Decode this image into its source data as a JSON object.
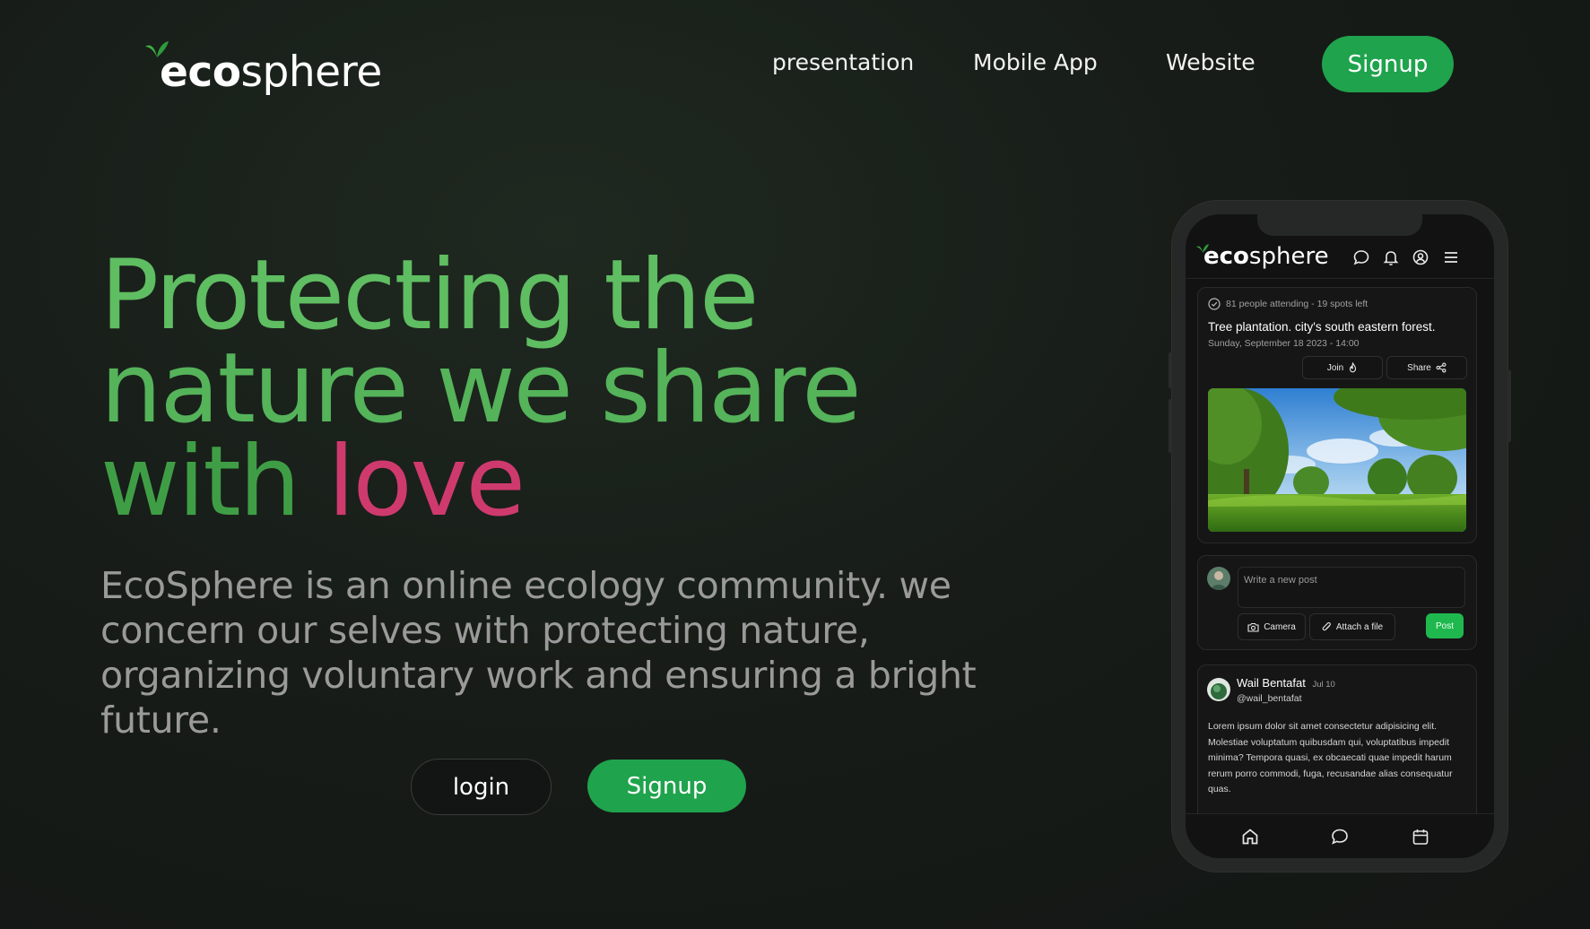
{
  "brand": {
    "bold": "eco",
    "light": "sphere",
    "accent": "#1fa34c",
    "leaf_color": "#3cb043"
  },
  "nav": {
    "items": [
      {
        "label": "presentation"
      },
      {
        "label": "Mobile App"
      },
      {
        "label": "Website"
      }
    ],
    "signup_label": "Signup"
  },
  "hero": {
    "line1": "Protecting the",
    "line2": "nature we share",
    "line3_prefix": "with ",
    "line3_highlight": "love",
    "description": "EcoSphere is an online ecology community. we concern our selves with protecting nature, organizing voluntary work and ensuring a bright future.",
    "login_label": "login",
    "signup_label": "Signup",
    "highlight_color": "#cf3a6e"
  },
  "phone": {
    "header": {
      "logo_bold": "eco",
      "logo_light": "sphere",
      "icons": [
        "chat-icon",
        "bell-icon",
        "user-circle-icon",
        "menu-icon"
      ]
    },
    "event": {
      "attendance": "81 people attending - 19 spots left",
      "title": "Tree plantation. city's south eastern forest.",
      "datetime": "Sunday, September 18 2023 - 14:00",
      "join_label": "Join",
      "share_label": "Share"
    },
    "composer": {
      "placeholder": "Write a new post",
      "camera_label": "Camera",
      "attach_label": "Attach a file",
      "post_label": "Post"
    },
    "post": {
      "author": "Wail Bentafat",
      "date": "Jul 10",
      "handle": "@wail_bentafat",
      "body": "Lorem ipsum dolor sit amet consectetur adipisicing elit. Molestiae voluptatum quibusdam qui, voluptatibus impedit minima? Tempora quasi, ex obcaecati quae impedit harum rerum porro commodi, fuga, recusandae alias consequatur quas."
    },
    "bottom_nav": [
      "home-icon",
      "chat-icon",
      "calendar-icon"
    ]
  }
}
